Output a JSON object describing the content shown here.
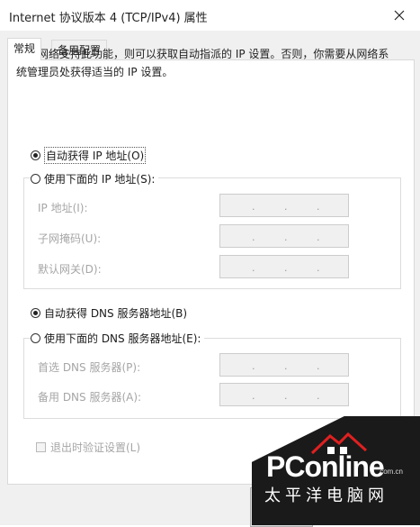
{
  "window": {
    "title": "Internet 协议版本 4 (TCP/IPv4) 属性"
  },
  "tabs": [
    {
      "label": "常规",
      "active": true
    },
    {
      "label": "备用配置",
      "active": false
    }
  ],
  "description": "如果网络支持此功能，则可以获取自动指派的 IP 设置。否则，你需要从网络系统管理员处获得适当的 IP 设置。",
  "ip": {
    "auto_label": "自动获得 IP 地址(O)",
    "auto_checked": true,
    "manual_label": "使用下面的 IP 地址(S):",
    "manual_checked": false,
    "fields": [
      {
        "label": "IP 地址(I):",
        "value": ". . ."
      },
      {
        "label": "子网掩码(U):",
        "value": ". . ."
      },
      {
        "label": "默认网关(D):",
        "value": ". . ."
      }
    ]
  },
  "dns": {
    "auto_label": "自动获得 DNS 服务器地址(B)",
    "auto_checked": true,
    "manual_label": "使用下面的 DNS 服务器地址(E):",
    "manual_checked": false,
    "fields": [
      {
        "label": "首选 DNS 服务器(P):",
        "value": ". . ."
      },
      {
        "label": "备用 DNS 服务器(A):",
        "value": ". . ."
      }
    ]
  },
  "validate": {
    "label": "退出时验证设置(L)",
    "checked": false,
    "enabled": false
  },
  "watermark": {
    "brand": "PConline",
    "domain": ".com.cn",
    "sub": "太平洋电脑网"
  },
  "icons": {
    "close": "close-icon",
    "watermark_logo": "pconline-logo-icon"
  },
  "colors": {
    "disabled_text": "#a6a6a6",
    "panel_bg": "#ffffff",
    "dialog_bg": "#f0f0f0"
  }
}
